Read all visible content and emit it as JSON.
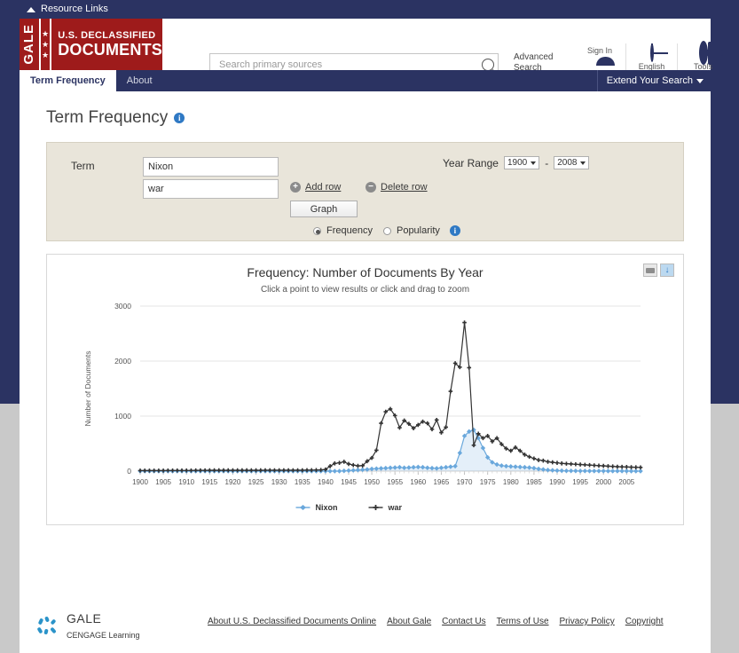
{
  "resource_links": {
    "label": "Resource Links",
    "icon": "caret-up-icon"
  },
  "masthead": {
    "logo": {
      "gale": "GALE",
      "line1": "U.S. DECLASSIFIED",
      "line2": "DOCUMENTS",
      "stars": "★"
    },
    "search": {
      "placeholder": "Search primary sources",
      "value": "",
      "icon": "search-icon"
    },
    "advanced_search": "Advanced Search",
    "items": [
      {
        "label": "Sign In",
        "icon": "person-icon"
      },
      {
        "label": "English",
        "icon": "globe-icon"
      },
      {
        "label": "Tools",
        "icon": "gear-icon"
      }
    ]
  },
  "tabs": [
    {
      "label": "Term Frequency",
      "active": true
    },
    {
      "label": "About",
      "active": false
    }
  ],
  "extend_search": {
    "label": "Extend Your Search",
    "icon": "chevron-down-icon"
  },
  "page": {
    "title": "Term Frequency",
    "info_icon": "info-icon"
  },
  "form": {
    "term_label": "Term",
    "terms": [
      "Nixon",
      "war"
    ],
    "add_row": "Add row",
    "delete_row": "Delete row",
    "graph_button": "Graph",
    "modes": [
      {
        "label": "Frequency",
        "selected": true
      },
      {
        "label": "Popularity",
        "selected": false
      }
    ],
    "year_range": {
      "label": "Year Range",
      "from": "1900",
      "separator": "-",
      "to": "2008"
    }
  },
  "chart_panel": {
    "title": "Frequency: Number of Documents By Year",
    "subtitle": "Click a point to view results or click and drag to zoom",
    "print_icon": "print-icon",
    "download_icon": "download-icon"
  },
  "chart_data": {
    "type": "line",
    "title": "Frequency: Number of Documents By Year",
    "xlabel": "",
    "ylabel": "Number of Documents",
    "xlim": [
      1900,
      2008
    ],
    "ylim": [
      0,
      3000
    ],
    "yticks": [
      0,
      1000,
      2000,
      3000
    ],
    "xticks": [
      1900,
      1905,
      1910,
      1915,
      1920,
      1925,
      1930,
      1935,
      1940,
      1945,
      1950,
      1955,
      1960,
      1965,
      1970,
      1975,
      1980,
      1985,
      1990,
      1995,
      2000,
      2005
    ],
    "grid": "horizontal",
    "legend_position": "bottom",
    "colors": {
      "Nixon": "#6aa8dc",
      "war": "#333333"
    },
    "x": [
      1900,
      1901,
      1902,
      1903,
      1904,
      1905,
      1906,
      1907,
      1908,
      1909,
      1910,
      1911,
      1912,
      1913,
      1914,
      1915,
      1916,
      1917,
      1918,
      1919,
      1920,
      1921,
      1922,
      1923,
      1924,
      1925,
      1926,
      1927,
      1928,
      1929,
      1930,
      1931,
      1932,
      1933,
      1934,
      1935,
      1936,
      1937,
      1938,
      1939,
      1940,
      1941,
      1942,
      1943,
      1944,
      1945,
      1946,
      1947,
      1948,
      1949,
      1950,
      1951,
      1952,
      1953,
      1954,
      1955,
      1956,
      1957,
      1958,
      1959,
      1960,
      1961,
      1962,
      1963,
      1964,
      1965,
      1966,
      1967,
      1968,
      1969,
      1970,
      1971,
      1972,
      1973,
      1974,
      1975,
      1976,
      1977,
      1978,
      1979,
      1980,
      1981,
      1982,
      1983,
      1984,
      1985,
      1986,
      1987,
      1988,
      1989,
      1990,
      1991,
      1992,
      1993,
      1994,
      1995,
      1996,
      1997,
      1998,
      1999,
      2000,
      2001,
      2002,
      2003,
      2004,
      2005,
      2006,
      2007,
      2008
    ],
    "series": [
      {
        "name": "Nixon",
        "marker": "diamond",
        "values": [
          0,
          0,
          0,
          0,
          0,
          0,
          0,
          0,
          0,
          0,
          0,
          0,
          0,
          0,
          0,
          0,
          0,
          0,
          0,
          0,
          0,
          0,
          0,
          0,
          0,
          0,
          0,
          0,
          0,
          0,
          0,
          0,
          0,
          0,
          0,
          0,
          0,
          0,
          0,
          0,
          0,
          0,
          0,
          0,
          5,
          10,
          15,
          20,
          25,
          30,
          40,
          45,
          50,
          55,
          60,
          65,
          70,
          60,
          65,
          70,
          75,
          70,
          60,
          55,
          50,
          60,
          70,
          80,
          90,
          330,
          640,
          720,
          750,
          600,
          420,
          250,
          160,
          120,
          100,
          90,
          85,
          80,
          75,
          70,
          65,
          55,
          40,
          30,
          20,
          15,
          10,
          8,
          5,
          5,
          4,
          3,
          3,
          2,
          2,
          2,
          2,
          1,
          1,
          1,
          1,
          1,
          0,
          0,
          0
        ]
      },
      {
        "name": "war",
        "marker": "cross",
        "values": [
          10,
          10,
          10,
          10,
          10,
          10,
          12,
          12,
          12,
          12,
          12,
          12,
          14,
          14,
          14,
          15,
          15,
          15,
          15,
          15,
          15,
          15,
          15,
          15,
          15,
          15,
          15,
          16,
          16,
          16,
          16,
          16,
          16,
          16,
          16,
          16,
          18,
          18,
          20,
          22,
          30,
          90,
          140,
          150,
          170,
          130,
          110,
          95,
          100,
          180,
          240,
          380,
          870,
          1080,
          1130,
          1010,
          790,
          920,
          860,
          780,
          840,
          900,
          870,
          760,
          930,
          700,
          800,
          1450,
          1960,
          1890,
          2700,
          1880,
          470,
          680,
          600,
          640,
          540,
          600,
          490,
          410,
          370,
          430,
          370,
          300,
          260,
          230,
          200,
          190,
          170,
          160,
          150,
          140,
          135,
          130,
          125,
          120,
          115,
          110,
          105,
          100,
          95,
          90,
          85,
          80,
          78,
          75,
          72,
          70,
          68,
          65
        ]
      }
    ]
  },
  "footer": {
    "logo": {
      "name": "GALE",
      "tagline": "CENGAGE Learning"
    },
    "links": [
      "About U.S. Declassified Documents Online",
      "About Gale",
      "Contact Us",
      "Terms of Use",
      "Privacy Policy",
      "Copyright"
    ]
  }
}
